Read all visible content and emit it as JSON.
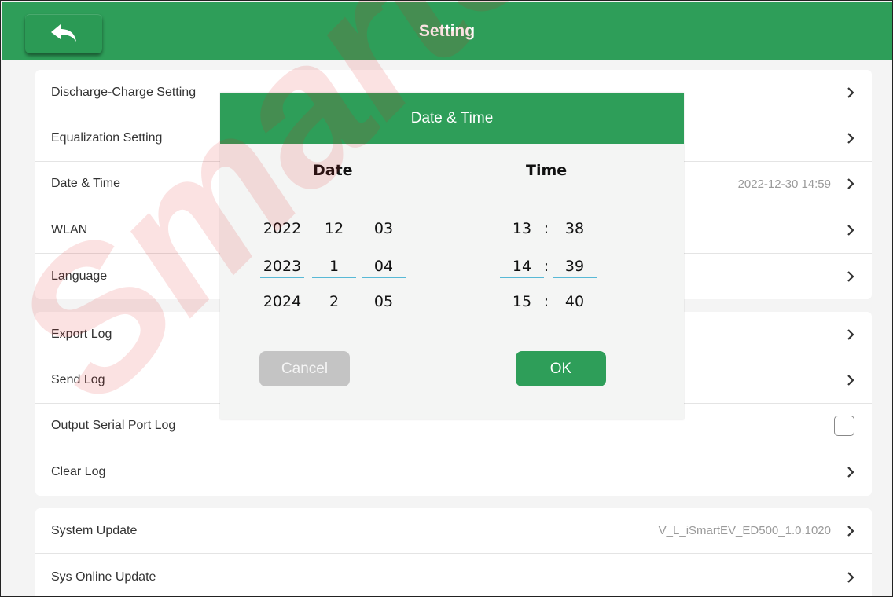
{
  "header": {
    "title": "Setting",
    "back_icon": "back-arrow-icon"
  },
  "settings": {
    "group1": [
      {
        "label": "Discharge-Charge Setting",
        "value": "",
        "control": "chevron"
      },
      {
        "label": "Equalization Setting",
        "value": "",
        "control": "chevron"
      },
      {
        "label": "Date & Time",
        "value": "2022-12-30 14:59",
        "control": "chevron"
      },
      {
        "label": "WLAN",
        "value": "",
        "control": "chevron"
      },
      {
        "label": "Language",
        "value": "",
        "control": "chevron"
      }
    ],
    "group2": [
      {
        "label": "Export Log",
        "value": "",
        "control": "chevron"
      },
      {
        "label": "Send Log",
        "value": "",
        "control": "chevron"
      },
      {
        "label": "Output Serial Port Log",
        "value": "",
        "control": "checkbox",
        "checked": false
      },
      {
        "label": "Clear Log",
        "value": "",
        "control": "chevron"
      }
    ],
    "group3": [
      {
        "label": "System Update",
        "value": "V_L_iSmartEV_ED500_1.0.1020",
        "control": "chevron"
      },
      {
        "label": "Sys Online Update",
        "value": "",
        "control": "chevron"
      }
    ]
  },
  "dialog": {
    "title": "Date & Time",
    "date_heading": "Date",
    "time_heading": "Time",
    "date_rows": [
      {
        "year": "2022",
        "month": "12",
        "day": "03"
      },
      {
        "year": "2023",
        "month": "1",
        "day": "04"
      },
      {
        "year": "2024",
        "month": "2",
        "day": "05"
      }
    ],
    "time_rows": [
      {
        "hour": "13",
        "sep": ":",
        "minute": "38"
      },
      {
        "hour": "14",
        "sep": ":",
        "minute": "39"
      },
      {
        "hour": "15",
        "sep": ":",
        "minute": "40"
      }
    ],
    "cancel_label": "Cancel",
    "ok_label": "OK"
  },
  "watermark": {
    "text": "SmartSafe",
    "color": "#e11e1e"
  },
  "colors": {
    "brand_green": "#2e9e59",
    "picker_underline": "#58b9d6",
    "disabled_button": "#c4c4c4"
  }
}
